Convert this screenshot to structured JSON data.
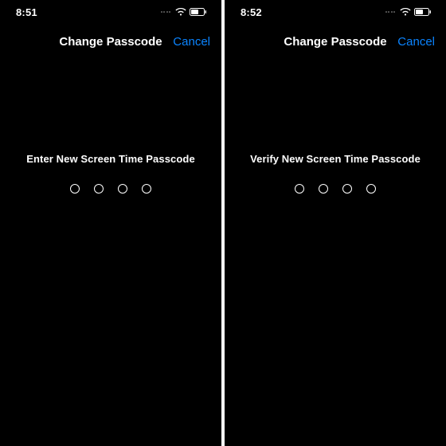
{
  "screens": [
    {
      "status_time": "8:51",
      "nav_title": "Change Passcode",
      "nav_cancel": "Cancel",
      "prompt": "Enter New Screen Time Passcode"
    },
    {
      "status_time": "8:52",
      "nav_title": "Change Passcode",
      "nav_cancel": "Cancel",
      "prompt": "Verify New Screen Time Passcode"
    }
  ],
  "colors": {
    "accent": "#0b84ff"
  }
}
